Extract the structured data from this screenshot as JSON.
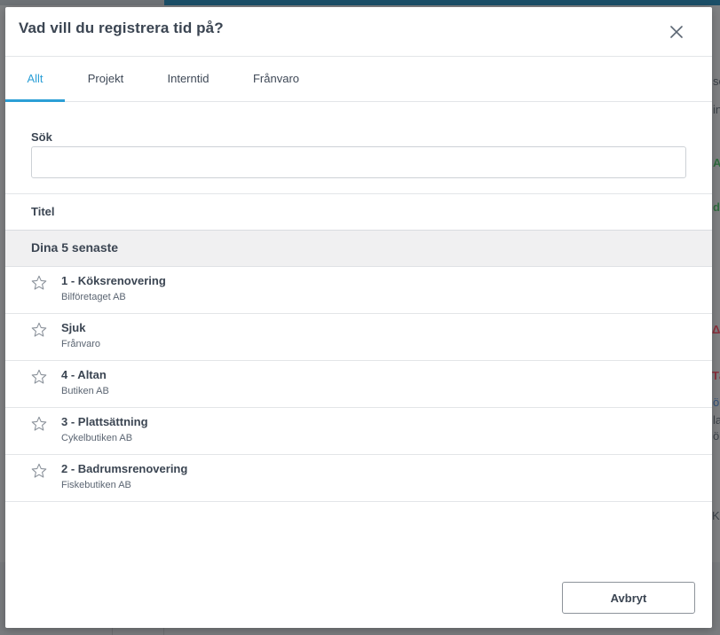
{
  "background": {
    "edge_texts": [
      "se",
      "in",
      "A",
      "d",
      "Δ",
      "Tä",
      "ö",
      "la",
      "ö",
      "K"
    ]
  },
  "modal": {
    "title": "Vad vill du registrera tid på?",
    "close_icon": "close-icon"
  },
  "tabs": [
    {
      "label": "Allt",
      "active": true
    },
    {
      "label": "Projekt",
      "active": false
    },
    {
      "label": "Interntid",
      "active": false
    },
    {
      "label": "Frånvaro",
      "active": false
    }
  ],
  "search": {
    "label": "Sök",
    "value": "",
    "placeholder": ""
  },
  "table": {
    "column_header": "Titel",
    "group_label": "Dina 5 senaste",
    "items": [
      {
        "title": "1 - Köksrenovering",
        "subtitle": "Bilföretaget AB",
        "icon": "star-icon",
        "starred": false
      },
      {
        "title": "Sjuk",
        "subtitle": "Frånvaro",
        "icon": "star-icon",
        "starred": false
      },
      {
        "title": "4 - Altan",
        "subtitle": "Butiken AB",
        "icon": "star-icon",
        "starred": false
      },
      {
        "title": "3 - Plattsättning",
        "subtitle": "Cykelbutiken AB",
        "icon": "star-icon",
        "starred": false
      },
      {
        "title": "2 - Badrumsrenovering",
        "subtitle": "Fiskebutiken AB",
        "icon": "star-icon",
        "starred": false
      }
    ]
  },
  "footer": {
    "cancel_label": "Avbryt"
  },
  "colors": {
    "accent": "#2c9fd6",
    "text": "#3b4552",
    "overlay": "#7f8183",
    "topbar": "#1b4f68"
  }
}
